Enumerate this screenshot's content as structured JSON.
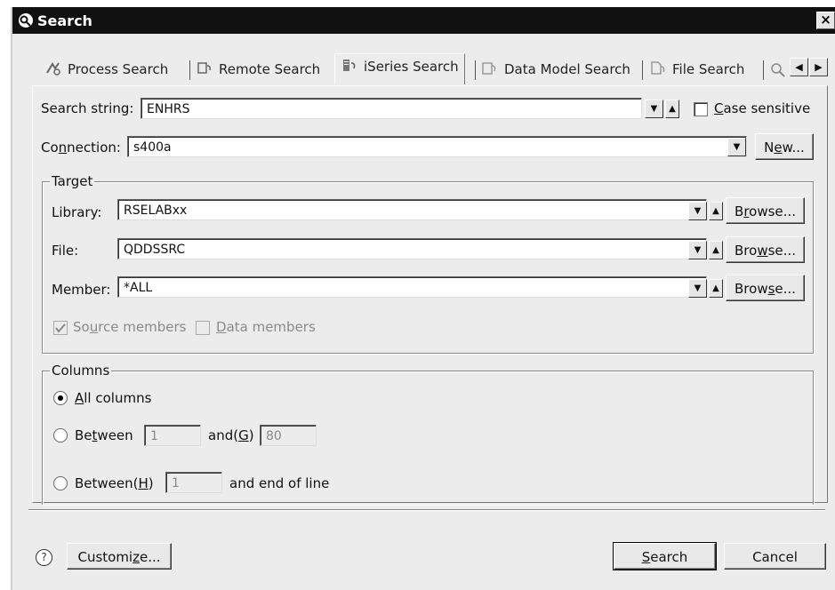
{
  "window": {
    "title": "Search",
    "close_glyph": "×"
  },
  "tabs": [
    {
      "label": "Process Search",
      "icon": "process-search-icon"
    },
    {
      "label": "Remote Search",
      "icon": "remote-search-icon"
    },
    {
      "label": "iSeries Search",
      "icon": "iseries-search-icon",
      "active": true
    },
    {
      "label": "Data Model Search",
      "icon": "data-model-search-icon"
    },
    {
      "label": "File Search",
      "icon": "file-search-icon"
    }
  ],
  "tab_scroll": {
    "left": "◀",
    "right": "▶"
  },
  "search_string": {
    "label_pre": "Search string:",
    "value": "ENHRS"
  },
  "case_sensitive": {
    "label_ul": "C",
    "label_rest": "ase sensitive",
    "checked": false
  },
  "connection": {
    "label_pre": "Co",
    "label_ul": "n",
    "label_rest": "nection:",
    "value": "s400a",
    "new_pre": "N",
    "new_ul": "e",
    "new_rest": "w..."
  },
  "target": {
    "caption": "Target",
    "library": {
      "label": "Library:",
      "value": "RSELABxx",
      "browse_pre": "B",
      "browse_ul": "r",
      "browse_rest": "owse..."
    },
    "file": {
      "label": "File:",
      "value": "QDDSSRC",
      "browse_pre": "Bro",
      "browse_ul": "w",
      "browse_rest": "se..."
    },
    "member": {
      "label": "Member:",
      "value": "*ALL",
      "browse_pre": "Brow",
      "browse_ul": "s",
      "browse_rest": "e..."
    },
    "source_members": {
      "label_pre": "So",
      "label_ul": "u",
      "label_rest": "rce members",
      "checked": true
    },
    "data_members": {
      "label_ul": "D",
      "label_rest": "ata members",
      "checked": false
    }
  },
  "columns": {
    "caption": "Columns",
    "all": {
      "label_ul": "A",
      "label_rest": "ll columns",
      "selected": true
    },
    "between": {
      "label_pre": "Be",
      "label_ul": "t",
      "label_rest": "ween",
      "from": "1",
      "and_pre": "and(",
      "and_ul": "G",
      "and_rest": ")",
      "to": "80"
    },
    "between_end": {
      "label_pre": "Between(",
      "label_ul": "H",
      "label_rest": ")",
      "from": "1",
      "suffix": "and end of line"
    }
  },
  "footer": {
    "help": "?",
    "customize_pre": "Customi",
    "customize_ul": "z",
    "customize_rest": "e...",
    "search_ul": "S",
    "search_rest": "earch",
    "cancel": "Cancel"
  },
  "arrows": {
    "down": "▼",
    "up": "▲"
  }
}
